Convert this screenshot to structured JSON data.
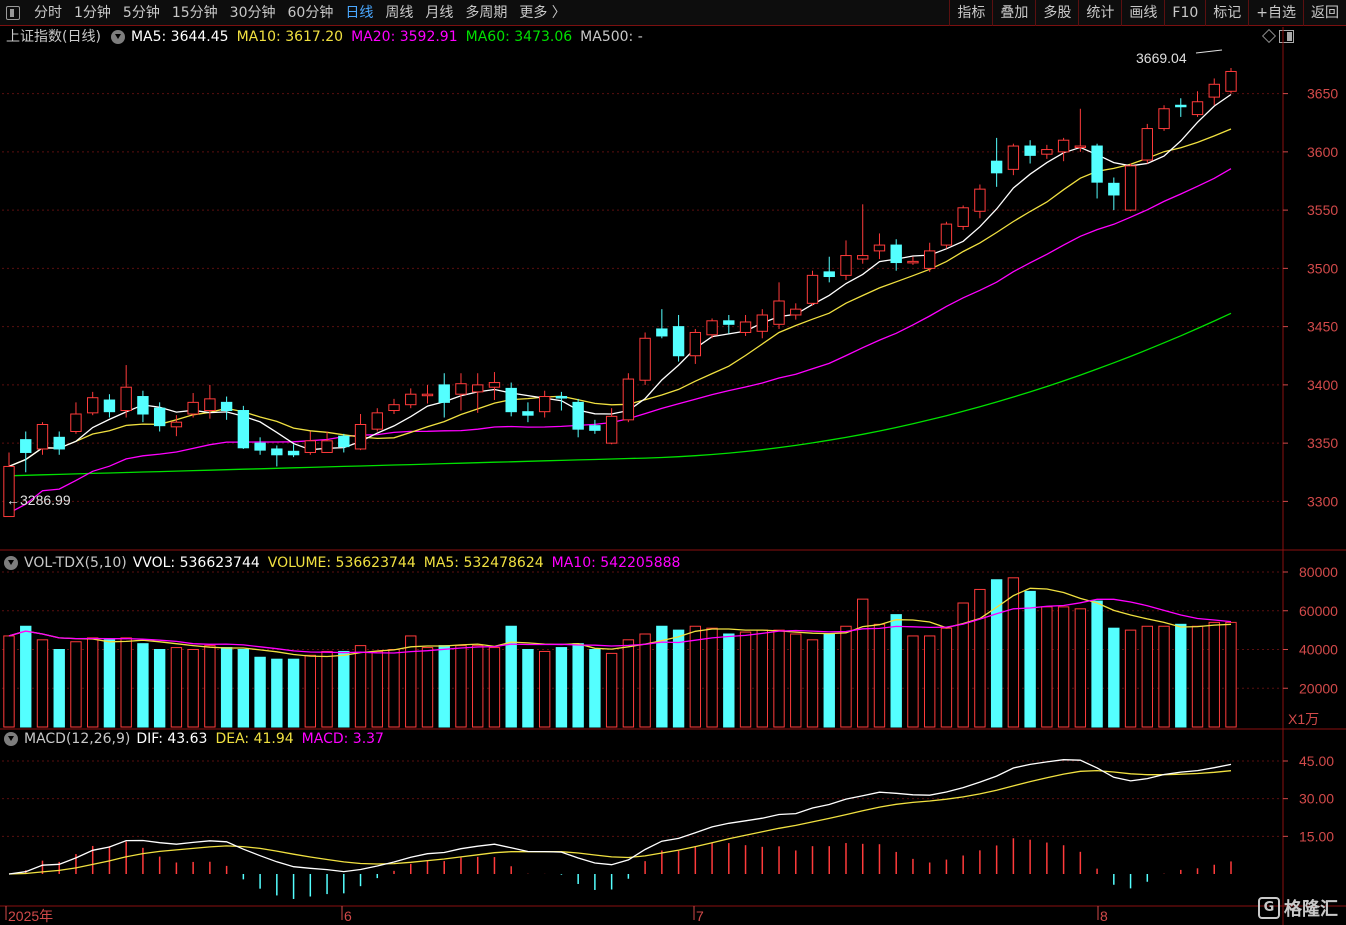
{
  "toolbar": {
    "periods": [
      "分时",
      "1分钟",
      "5分钟",
      "15分钟",
      "30分钟",
      "60分钟",
      "日线",
      "周线",
      "月线",
      "多周期",
      "更多 〉"
    ],
    "active": "日线",
    "right": [
      "指标",
      "叠加",
      "多股",
      "统计",
      "画线",
      "F10",
      "标记",
      "+自选",
      "返回"
    ]
  },
  "price_panel": {
    "name": "上证指数(日线)",
    "ma": [
      {
        "label": "MA5: 3644.45",
        "color": "#ffffff"
      },
      {
        "label": "MA10: 3617.20",
        "color": "#f0e040"
      },
      {
        "label": "MA20: 3592.91",
        "color": "#ff00ff"
      },
      {
        "label": "MA60: 3473.06",
        "color": "#00e000"
      },
      {
        "label": "MA500: -",
        "color": "#c8c8c8"
      }
    ],
    "high_label": "3669.04",
    "low_label": "←3286.99",
    "yticks": [
      3300,
      3350,
      3400,
      3450,
      3500,
      3550,
      3600,
      3650
    ]
  },
  "volume_panel": {
    "name": "VOL-TDX(5,10)",
    "items": [
      {
        "label": "VVOL: 536623744",
        "color": "#ffffff"
      },
      {
        "label": "VOLUME: 536623744",
        "color": "#f0e040"
      },
      {
        "label": "MA5: 532478624",
        "color": "#f0e040"
      },
      {
        "label": "MA10: 542205888",
        "color": "#ff00ff"
      }
    ],
    "yticks": [
      "80000",
      "60000",
      "40000",
      "20000"
    ],
    "unit": "X1万"
  },
  "macd_panel": {
    "name": "MACD(12,26,9)",
    "items": [
      {
        "label": "DIF: 43.63",
        "color": "#ffffff"
      },
      {
        "label": "DEA: 41.94",
        "color": "#f0e040"
      },
      {
        "label": "MACD: 3.37",
        "color": "#ff00ff"
      }
    ],
    "yticks": [
      "45.00",
      "30.00",
      "15.00"
    ]
  },
  "x_axis": [
    "2025年",
    "6",
    "7",
    "8"
  ],
  "watermark": "格隆汇",
  "colors": {
    "up": "#ff3b3b",
    "down": "#54ffff",
    "axis": "#d24a4a",
    "grid": "#5a0f0f"
  },
  "chart_data": {
    "type": "candlestick",
    "candles": [
      [
        3287,
        3330,
        3287,
        3342
      ],
      [
        3353,
        3342,
        3325,
        3360
      ],
      [
        3345,
        3366,
        3340,
        3368
      ],
      [
        3355,
        3345,
        3340,
        3360
      ],
      [
        3360,
        3375,
        3358,
        3385
      ],
      [
        3376,
        3389,
        3374,
        3394
      ],
      [
        3387,
        3377,
        3372,
        3392
      ],
      [
        3378,
        3398,
        3372,
        3417
      ],
      [
        3390,
        3375,
        3368,
        3395
      ],
      [
        3380,
        3365,
        3360,
        3385
      ],
      [
        3364,
        3368,
        3356,
        3374
      ],
      [
        3375,
        3385,
        3372,
        3393
      ],
      [
        3378,
        3388,
        3371,
        3400
      ],
      [
        3385,
        3378,
        3370,
        3390
      ],
      [
        3378,
        3346,
        3345,
        3382
      ],
      [
        3350,
        3344,
        3340,
        3355
      ],
      [
        3345,
        3340,
        3330,
        3348
      ],
      [
        3343,
        3340,
        3338,
        3349
      ],
      [
        3342,
        3352,
        3340,
        3360
      ],
      [
        3342,
        3352,
        3343,
        3360
      ],
      [
        3356,
        3347,
        3342,
        3358
      ],
      [
        3345,
        3366,
        3344,
        3375
      ],
      [
        3362,
        3376,
        3360,
        3380
      ],
      [
        3378,
        3383,
        3375,
        3388
      ],
      [
        3383,
        3392,
        3380,
        3397
      ],
      [
        3392,
        3392,
        3384,
        3400
      ],
      [
        3400,
        3385,
        3372,
        3410
      ],
      [
        3392,
        3401,
        3378,
        3410
      ],
      [
        3394,
        3400,
        3376,
        3410
      ],
      [
        3398,
        3402,
        3387,
        3411
      ],
      [
        3397,
        3377,
        3373,
        3402
      ],
      [
        3377,
        3374,
        3368,
        3385
      ],
      [
        3377,
        3390,
        3372,
        3395
      ],
      [
        3390,
        3389,
        3378,
        3394
      ],
      [
        3385,
        3362,
        3355,
        3388
      ],
      [
        3365,
        3361,
        3358,
        3370
      ],
      [
        3350,
        3373,
        3349,
        3380
      ],
      [
        3370,
        3405,
        3368,
        3410
      ],
      [
        3404,
        3440,
        3400,
        3445
      ],
      [
        3448,
        3442,
        3440,
        3465
      ],
      [
        3450,
        3425,
        3420,
        3460
      ],
      [
        3425,
        3445,
        3418,
        3448
      ],
      [
        3443,
        3455,
        3440,
        3457
      ],
      [
        3455,
        3452,
        3444,
        3460
      ],
      [
        3445,
        3454,
        3442,
        3460
      ],
      [
        3446,
        3460,
        3440,
        3465
      ],
      [
        3452,
        3472,
        3448,
        3488
      ],
      [
        3460,
        3465,
        3456,
        3470
      ],
      [
        3470,
        3494,
        3468,
        3498
      ],
      [
        3497,
        3493,
        3488,
        3510
      ],
      [
        3494,
        3511,
        3490,
        3524
      ],
      [
        3508,
        3511,
        3504,
        3555
      ],
      [
        3515,
        3520,
        3508,
        3530
      ],
      [
        3520,
        3505,
        3498,
        3525
      ],
      [
        3506,
        3506,
        3503,
        3510
      ],
      [
        3500,
        3515,
        3497,
        3522
      ],
      [
        3520,
        3538,
        3517,
        3540
      ],
      [
        3536,
        3552,
        3533,
        3554
      ],
      [
        3549,
        3568,
        3543,
        3572
      ],
      [
        3592,
        3582,
        3570,
        3612
      ],
      [
        3585,
        3605,
        3580,
        3607
      ],
      [
        3605,
        3597,
        3590,
        3610
      ],
      [
        3598,
        3602,
        3594,
        3606
      ],
      [
        3600,
        3610,
        3592,
        3612
      ],
      [
        3605,
        3605,
        3600,
        3637
      ],
      [
        3605,
        3574,
        3560,
        3607
      ],
      [
        3573,
        3563,
        3550,
        3578
      ],
      [
        3550,
        3588,
        3549,
        3590
      ],
      [
        3593,
        3620,
        3590,
        3624
      ],
      [
        3620,
        3637,
        3618,
        3640
      ],
      [
        3640,
        3639,
        3630,
        3646
      ],
      [
        3632,
        3643,
        3630,
        3652
      ],
      [
        3647,
        3658,
        3640,
        3663
      ],
      [
        3652,
        3669,
        3650,
        3672
      ]
    ],
    "ma5_last": 3644.45,
    "ma10_last": 3617.2,
    "ma20_last": 3592.91,
    "ma60_last": 3473.06,
    "volume_wan": [
      47000,
      52000,
      45000,
      40000,
      44000,
      46000,
      45000,
      46000,
      43000,
      40000,
      41000,
      40000,
      42000,
      41000,
      40000,
      36000,
      35000,
      35000,
      37000,
      39000,
      39000,
      42000,
      39000,
      40000,
      47000,
      41000,
      42000,
      42000,
      42000,
      41000,
      52000,
      40000,
      39000,
      41000,
      43000,
      40000,
      38000,
      45000,
      48000,
      52000,
      50000,
      52000,
      51000,
      48000,
      49000,
      50000,
      50000,
      48000,
      45000,
      48000,
      52000,
      66000,
      53000,
      58000,
      47000,
      47000,
      51000,
      64000,
      71000,
      76000,
      77000,
      70000,
      62000,
      62000,
      61000,
      65000,
      51000,
      50000,
      52000,
      52000,
      53000,
      52000,
      54000,
      54000
    ],
    "volume_yrange": [
      0,
      80000
    ],
    "macd_dif_last": 43.63,
    "macd_dea_last": 41.94,
    "macd_hist_last": 3.37,
    "price_yrange": [
      3260,
      3690
    ]
  }
}
